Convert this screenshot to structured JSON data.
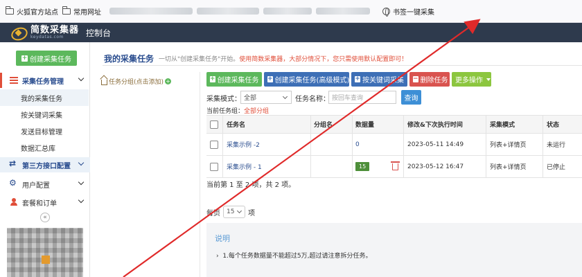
{
  "bookmarks": {
    "item1": "火狐官方站点",
    "item2": "常用网址",
    "item3": "书签一键采集"
  },
  "header": {
    "logo_name": "简数采集器",
    "logo_domain": "keydatas.com",
    "title": "控制台"
  },
  "sidebar": {
    "create_button": "创建采集任务",
    "task_menu": "采集任务管理",
    "sub_items": [
      "我的采集任务",
      "按关键词采集",
      "发送目标管理",
      "数据汇总库"
    ],
    "api_menu": "第三方接口配置",
    "user_menu": "用户配置",
    "order_menu": "套餐和订单",
    "collapse": "«"
  },
  "main": {
    "title": "我的采集任务",
    "subtitle_prefix": "一切从\"创建采集任务\"开始。",
    "subtitle_red": "使用简数采集器，大部分情况下，您只需使用默认配置即可！",
    "group_link": "任务分组(点击添加)",
    "group_plus": "+"
  },
  "toolbar": {
    "create": "创建采集任务",
    "create_advanced": "创建采集任务(高级模式)",
    "keyword": "按关键词采集",
    "delete": "删除任务",
    "more": "更多操作"
  },
  "filter": {
    "mode_label": "采集模式：",
    "mode_value": "全部",
    "name_label": "任务名称：",
    "name_placeholder": "按回车查询",
    "query_button": "查询",
    "group_label": "当前任务组：",
    "group_value": "全部分组"
  },
  "table": {
    "headers": [
      "任务名",
      "分组名",
      "数据量",
      "修改&下次执行时间",
      "采集模式",
      "状态"
    ],
    "rows": [
      {
        "name": "采集示例 -2",
        "group": "",
        "count": "0",
        "time": "2023-05-11 14:49",
        "mode": "列表+详情页",
        "status": "未运行"
      },
      {
        "name": "采集示例 - 1",
        "group": "",
        "count": "15",
        "time": "2023-05-12 16:47",
        "mode": "列表+详情页",
        "status": "已停止"
      }
    ]
  },
  "pager": {
    "summary": "当前第 1 至 2 项，共 2 项。",
    "per_page_prefix": "每页",
    "per_page_value": "15",
    "per_page_suffix": "项"
  },
  "note": {
    "title": "说明",
    "item1": "1.每个任务数据量不能超过5万,超过请注意拆分任务。"
  },
  "colors": {
    "header_bg": "#2e3a4d",
    "green": "#5cb85c",
    "blue": "#3d6fb6",
    "red": "#d9534f",
    "arrow": "#e02a2a"
  }
}
